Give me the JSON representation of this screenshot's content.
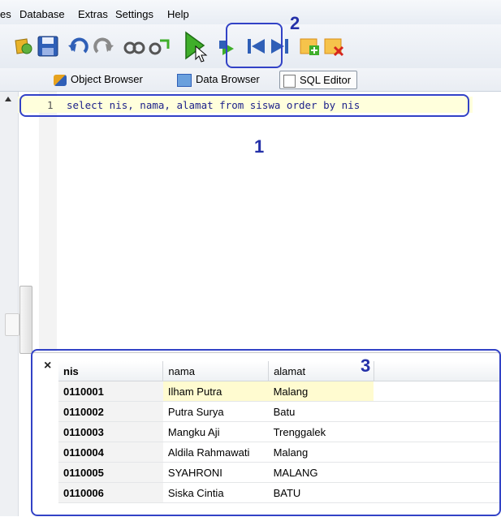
{
  "menu": {
    "items": [
      "es",
      "Database",
      "Extras",
      "Settings",
      "Help"
    ]
  },
  "toolbar": {
    "icons": [
      "connect-icon",
      "save-icon",
      "undo-icon",
      "redo-icon",
      "view-icon",
      "refresh-icon",
      "execute-icon",
      "execute-step-icon",
      "first-icon",
      "last-icon",
      "add-row-icon",
      "delete-row-icon"
    ]
  },
  "tabs": {
    "object_browser": "Object Browser",
    "data_browser": "Data Browser",
    "sql_editor": "SQL Editor"
  },
  "editor": {
    "line_number": "1",
    "code": "select nis, nama, alamat from siswa order by nis"
  },
  "annotations": {
    "one": "1",
    "two": "2",
    "three": "3"
  },
  "results": {
    "close": "×",
    "columns": [
      "nis",
      "nama",
      "alamat"
    ],
    "rows": [
      {
        "nis": "0110001",
        "nama": "Ilham Putra",
        "alamat": "Malang"
      },
      {
        "nis": "0110002",
        "nama": "Putra Surya",
        "alamat": "Batu"
      },
      {
        "nis": "0110003",
        "nama": "Mangku Aji",
        "alamat": "Trenggalek"
      },
      {
        "nis": "0110004",
        "nama": "Aldila Rahmawati",
        "alamat": "Malang"
      },
      {
        "nis": "0110005",
        "nama": "SYAHRONI",
        "alamat": "MALANG"
      },
      {
        "nis": "0110006",
        "nama": "Siska Cintia",
        "alamat": "BATU"
      }
    ]
  },
  "colors": {
    "annotation": "#3242c6",
    "highlight": "#ffffdc",
    "play_green": "#3fae2a"
  }
}
